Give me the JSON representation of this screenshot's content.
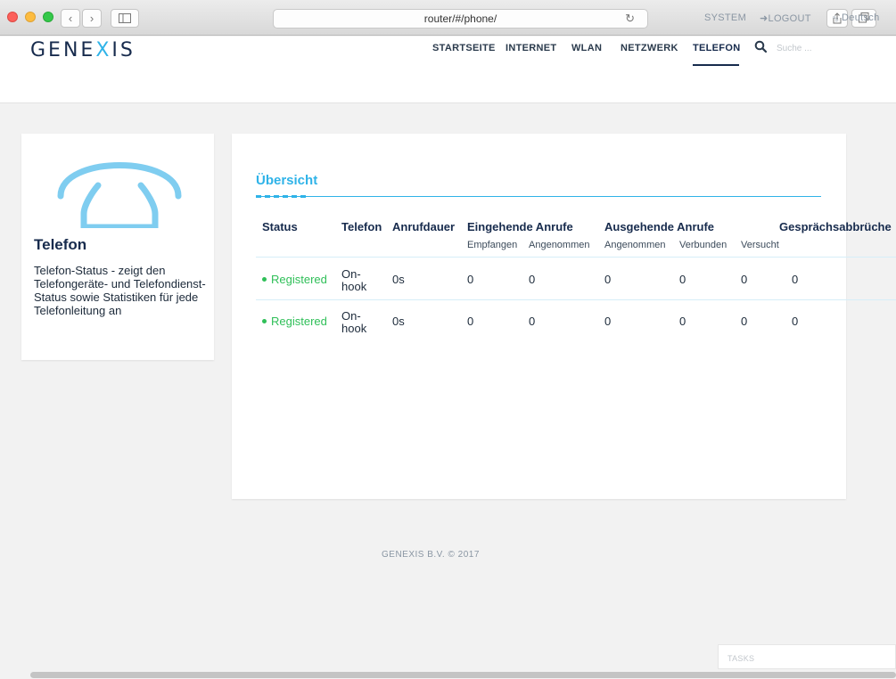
{
  "browser": {
    "url": "router/#/phone/",
    "back_icon": "‹",
    "forward_icon": "›"
  },
  "header": {
    "logo_part1": "GENE",
    "logo_x": "X",
    "logo_part2": "IS",
    "top_links": {
      "system": "SYSTEM",
      "logout": "LOGOUT",
      "language": "Deutsch"
    },
    "nav": [
      "STARTSEITE",
      "INTERNET",
      "WLAN",
      "NETZWERK",
      "TELEFON"
    ],
    "active_nav": "TELEFON",
    "search_placeholder": "Suche ..."
  },
  "sidebar": {
    "title": "Telefon",
    "description": "Telefon-Status - zeigt den Telefongeräte- und Telefondienst-Status sowie Statistiken für jede Telefonleitung an"
  },
  "overview": {
    "title": "Übersicht",
    "headers": {
      "status": "Status",
      "telefon": "Telefon",
      "anrufdauer": "Anrufdauer",
      "eingehend": "Eingehende Anrufe",
      "ausgehend": "Ausgehende Anrufe",
      "abbrueche": "Gesprächsabbrüche"
    },
    "subheaders": {
      "empfangen": "Empfangen",
      "angenommen_in": "Angenommen",
      "angenommen_out": "Angenommen",
      "verbunden": "Verbunden",
      "versucht": "Versucht"
    },
    "rows": [
      {
        "status": "Registered",
        "tel1": "On-",
        "tel2": "hook",
        "dauer": "0s",
        "empfangen": "0",
        "angenommen_in": "0",
        "angenommen_out": "0",
        "verbunden": "0",
        "versucht": "0",
        "abbrueche": "0"
      },
      {
        "status": "Registered",
        "tel1": "On-",
        "tel2": "hook",
        "dauer": "0s",
        "empfangen": "0",
        "angenommen_in": "0",
        "angenommen_out": "0",
        "verbunden": "0",
        "versucht": "0",
        "abbrueche": "0"
      }
    ]
  },
  "footer": "GENEXIS B.V. © 2017",
  "tasks_label": "TASKS",
  "colors": {
    "accent": "#2fb3e8",
    "brand": "#172b4d",
    "registered": "#2fbf58"
  }
}
